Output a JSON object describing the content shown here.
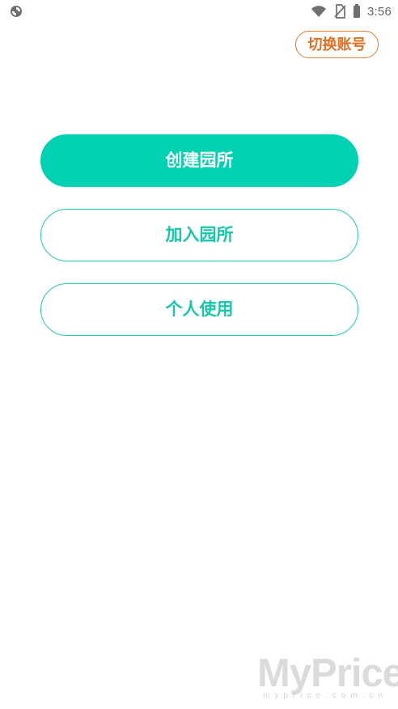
{
  "status_bar": {
    "time": "3:56",
    "icons": [
      "app-status-icon",
      "wifi-icon",
      "no-sim-icon",
      "battery-icon"
    ]
  },
  "header": {
    "switch_account_label": "切换账号"
  },
  "actions": {
    "create_kindergarten_label": "创建园所",
    "join_kindergarten_label": "加入园所",
    "personal_use_label": "个人使用"
  },
  "watermark": {
    "main": "MyPrice",
    "sub": "myprice.com.cn"
  },
  "colors": {
    "primary": "#00d1b2",
    "outline": "#20cdb2",
    "switch_accent": "#e47a2d",
    "status_icon": "#6f6f6f"
  }
}
